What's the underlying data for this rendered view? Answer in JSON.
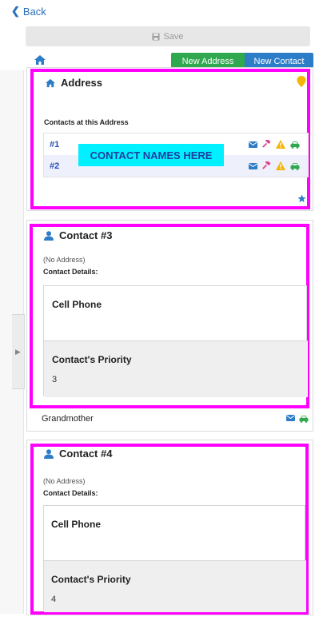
{
  "nav": {
    "back_label": "Back"
  },
  "toolbar": {
    "save_label": "Save"
  },
  "actions": {
    "new_address": "New Address",
    "new_contact": "New Contact"
  },
  "address": {
    "title": "Address",
    "contacts_label": "Contacts at this Address",
    "rows": [
      {
        "num": "#1"
      },
      {
        "num": "#2"
      }
    ],
    "names_placeholder": "CONTACT NAMES HERE"
  },
  "contacts": [
    {
      "title": "Contact #3",
      "address": "(No Address)",
      "details_label": "Contact Details:",
      "cell_phone_label": "Cell Phone",
      "priority_label": "Contact's Priority",
      "priority_value": "3",
      "relationship": "Grandmother"
    },
    {
      "title": "Contact #4",
      "address": "(No Address)",
      "details_label": "Contact Details:",
      "cell_phone_label": "Cell Phone",
      "priority_label": "Contact's Priority",
      "priority_value": "4"
    }
  ],
  "colors": {
    "highlight": "#ff00ff",
    "primary_blue": "#2d7cc8",
    "success_green": "#2fa84f",
    "names_highlight": "#00f0ff"
  }
}
